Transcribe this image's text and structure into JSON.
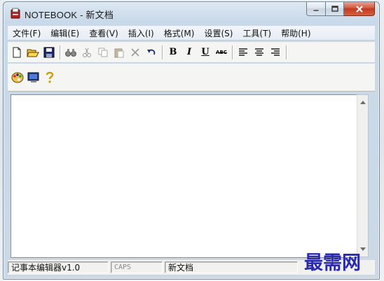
{
  "window": {
    "title": "NOTEBOOK - 新文档",
    "icon": "notebook-app-icon"
  },
  "menu": [
    {
      "label": "文件(F)"
    },
    {
      "label": "编辑(E)"
    },
    {
      "label": "查看(V)"
    },
    {
      "label": "插入(I)"
    },
    {
      "label": "格式(M)"
    },
    {
      "label": "设置(S)"
    },
    {
      "label": "工具(T)"
    },
    {
      "label": "帮助(H)"
    }
  ],
  "toolbar": {
    "format_bold": "B",
    "format_italic": "I",
    "format_underline": "U",
    "format_strike": "ABC"
  },
  "editor": {
    "content": ""
  },
  "status": {
    "app_version": "记事本编辑器v1.0",
    "caps": "CAPS",
    "document": "新文档"
  },
  "watermark": "最需网",
  "colors": {
    "watermark": "#2a2ab0",
    "close_button": "#c23a1f"
  }
}
